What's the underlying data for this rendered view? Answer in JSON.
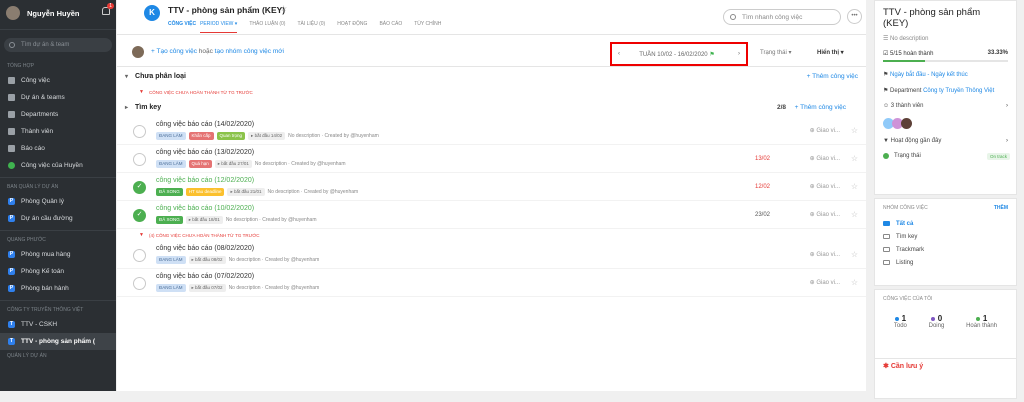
{
  "user": {
    "name": "Nguyễn Huyền",
    "notifications": "1"
  },
  "sidebar": {
    "search_placeholder": "Tìm dự án & team",
    "section_overview": "TỔNG HỢP",
    "overview_items": [
      "Công việc",
      "Dự án & teams",
      "Departments",
      "Thành viên",
      "Báo cáo",
      "Công việc của Huyền"
    ],
    "section_pm": "BAN QUẢN LÝ DỰ ÁN",
    "pm_items": [
      "Phòng Quản lý",
      "Dự án cầu đường"
    ],
    "section_qp": "QUANG PHƯỚC",
    "qp_items": [
      "Phòng mua hàng",
      "Phòng Kế toán",
      "Phòng bán hành"
    ],
    "section_cty": "CÔNG TY TRUYỀN THÔNG VIỆT",
    "cty_items": [
      "TTV - CSKH",
      "TTV - phòng sản phẩm ("
    ],
    "section_more": "QUẢN LÝ DỰ ÁN"
  },
  "header": {
    "title": "TTV - phòng sản phẩm (KEY)",
    "tabs": [
      "CÔNG VIỆC",
      "THẢO LUẬN (0)",
      "TÀI LIỆU (0)",
      "HOẠT ĐỘNG",
      "BÁO CÁO",
      "TÙY CHỈNH"
    ],
    "period_view": "Period view",
    "search_placeholder": "Tìm nhanh công việc"
  },
  "toolbar": {
    "new_task": "Tạo công việc",
    "or": " hoặc ",
    "new_group": "tạo nhóm công việc mới",
    "period": "TUẦN 10/02 - 16/02/2020",
    "status": "Trạng thái",
    "display": "Hiển thị"
  },
  "groups": {
    "uncategorized": "Chưa phân loại",
    "add_task": "+ Thêm công việc",
    "prev_unfinished": "CÔNG VIỆC CHƯA HOÀN THÀNH TỪ TG TRƯỚC",
    "tim_key": "Tìm key",
    "count": "2/8",
    "prev_unfinished_4": "(4) CÔNG VIỆC CHƯA HOÀN THÀNH TỪ TG TRƯỚC"
  },
  "tasks": [
    {
      "title": "công việc báo cáo (14/02/2020)",
      "status": "ĐANG LÀM",
      "tags": [
        "Khẩn cấp",
        "Quan trọng"
      ],
      "start": "bắt đầu 14/02",
      "meta": "No description · Created by @huyenham",
      "date": "",
      "assign": "Giao vi...",
      "done": false
    },
    {
      "title": "công việc báo cáo (13/02/2020)",
      "status": "ĐANG LÀM",
      "tags": [
        "Quá hạn"
      ],
      "start": "bắt đầu 27/01",
      "meta": "No description · Created by @huyenham",
      "date": "13/02",
      "assign": "Giao vi...",
      "done": false
    },
    {
      "title": "công việc báo cáo (12/02/2020)",
      "status": "ĐÃ XONG",
      "tags": [
        "HT sau deadline"
      ],
      "start": "bắt đầu 21/01",
      "meta": "No description · Created by @huyenham",
      "date": "12/02",
      "assign": "Giao vi...",
      "done": true
    },
    {
      "title": "công việc báo cáo (10/02/2020)",
      "status": "ĐÃ XONG",
      "tags": [],
      "start": "bắt đầu 18/01",
      "meta": "No description · Created by @huyenham",
      "date": "23/02",
      "assign": "Giao vi...",
      "done": true
    },
    {
      "title": "công việc báo cáo (08/02/2020)",
      "status": "ĐANG LÀM",
      "tags": [],
      "start": "bắt đầu 08/02",
      "meta": "No description · Created by @huyenham",
      "date": "",
      "assign": "Giao vi...",
      "done": false
    },
    {
      "title": "công việc báo cáo (07/02/2020)",
      "status": "ĐANG LÀM",
      "tags": [],
      "start": "bắt đầu 07/02",
      "meta": "No description · Created by @huyenham",
      "date": "",
      "assign": "Giao vi...",
      "done": false
    }
  ],
  "panel": {
    "title": "TTV - phòng sản phẩm (KEY)",
    "desc": "No description",
    "progress_text": "5/15 hoàn thành",
    "progress_pct": "33.33%",
    "progress": 0.3333,
    "dates": "Ngày bắt đầu - Ngày kết thúc",
    "department_label": "Department",
    "department": "Công ty Truyền Thông Việt",
    "members": "3 thành viên",
    "activity": "Hoạt động gần đây",
    "status": "Trạng thái",
    "status_value": "On track",
    "groups_title": "NHÓM CÔNG VIỆC",
    "groups_action": "THÊM",
    "group_items": [
      "Tất cả",
      "Tìm key",
      "Trackmark",
      "Listing"
    ],
    "my_tasks": "CÔNG VIỆC CỦA TÔI",
    "stats": [
      {
        "n": "1",
        "label": "Todo",
        "color": "#1e88e5"
      },
      {
        "n": "0",
        "label": "Doing",
        "color": "#7e57c2"
      },
      {
        "n": "1",
        "label": "Hoàn thành",
        "color": "#4caf50"
      }
    ],
    "warning": "Cần lưu ý"
  }
}
